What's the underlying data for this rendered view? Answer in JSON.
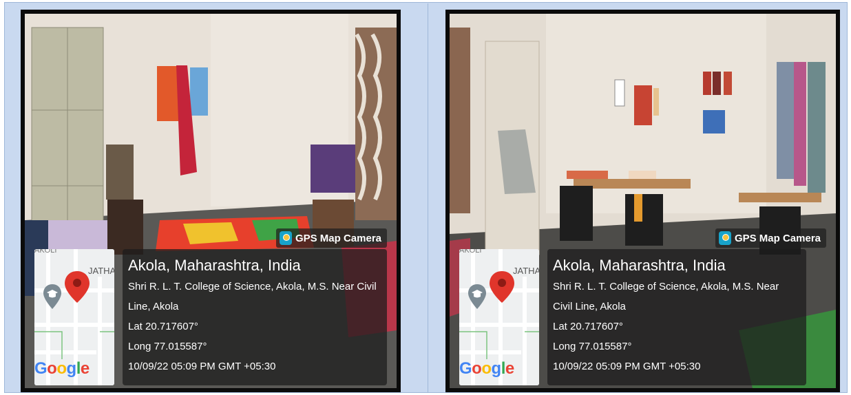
{
  "panels": [
    {
      "brand": "GPS Map Camera",
      "map_label": "JATHA",
      "map_label_top": "AKOLI",
      "location_title": "Akola, Maharashtra, India",
      "address": "Shri R. L. T. College of Science, Akola, M.S. Near Civil Line, Akola",
      "lat": "Lat 20.717607°",
      "long": "Long 77.015587°",
      "datetime": "10/09/22 05:09 PM GMT +05:30",
      "google_letters": [
        "G",
        "o",
        "o",
        "g",
        "l",
        "e"
      ]
    },
    {
      "brand": "GPS Map Camera",
      "map_label": "JATHA",
      "map_label_top": "AKOLI",
      "location_title": "Akola, Maharashtra, India",
      "address": "Shri R. L. T. College of Science, Akola, M.S. Near Civil Line, Akola",
      "lat": "Lat 20.717607°",
      "long": "Long 77.015587°",
      "datetime": "10/09/22 05:09 PM GMT +05:30",
      "google_letters": [
        "G",
        "o",
        "o",
        "g",
        "l",
        "e"
      ]
    }
  ],
  "colors": {
    "frame_bg": "#c9d9f0",
    "overlay": "#1c1c1c",
    "pin": "#e0352b",
    "brand_icon": "#18a3c9"
  }
}
